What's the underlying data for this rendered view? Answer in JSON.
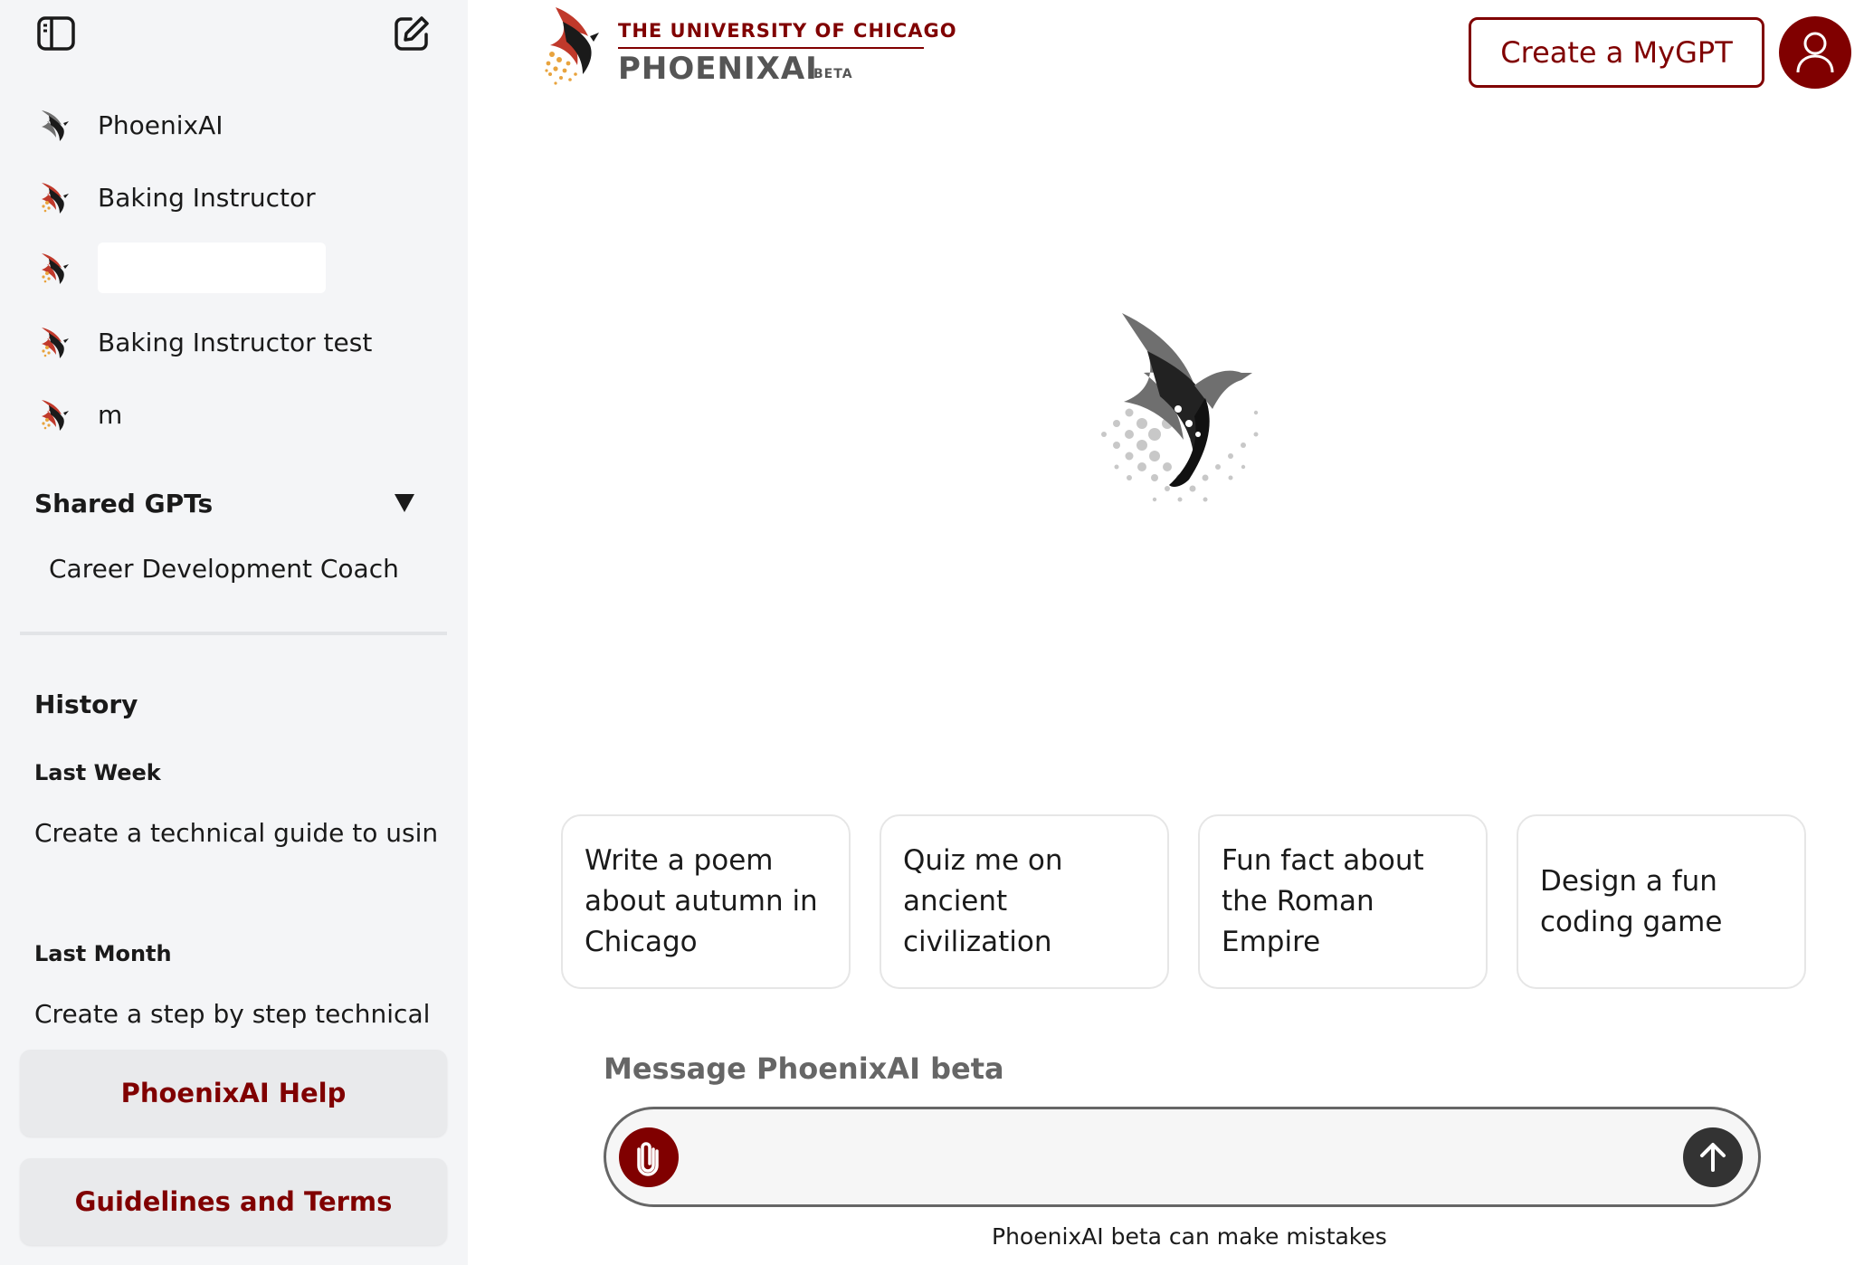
{
  "sidebar": {
    "toggle_icon": "sidebar-toggle-icon",
    "new_chat_icon": "edit-icon",
    "gpts": [
      {
        "label": "PhoenixAI",
        "icon": "phoenix-icon"
      },
      {
        "label": "Baking Instructor",
        "icon": "phoenix-icon"
      },
      {
        "label": "",
        "icon": "phoenix-icon"
      },
      {
        "label": "Baking Instructor test",
        "icon": "phoenix-icon"
      },
      {
        "label": "m",
        "icon": "phoenix-icon"
      }
    ],
    "shared_title": "Shared GPTs",
    "shared_items": [
      "Career Development Coach"
    ],
    "history_title": "History",
    "history": [
      {
        "group": "Last Week",
        "items": [
          "Create a technical guide to using"
        ]
      },
      {
        "group": "Last Month",
        "items": [
          "Create a step by step technical guide"
        ]
      }
    ],
    "help_label": "PhoenixAI Help",
    "terms_label": "Guidelines and Terms"
  },
  "header": {
    "logo_university": "THE UNIVERSITY OF CHICAGO",
    "logo_name": "PHOENIXAI",
    "logo_badge": "BETA",
    "create_label": "Create a MyGPT",
    "avatar_icon": "user-icon"
  },
  "main": {
    "suggestions": [
      "Write a poem about autumn in Chicago",
      "Quiz me on ancient civilization",
      "Fun fact about the Roman Empire",
      "Design a fun coding game"
    ],
    "message_label": "Message PhoenixAI beta",
    "message_placeholder": "",
    "disclaimer": "PhoenixAI beta can make mistakes"
  },
  "colors": {
    "brand": "#800000",
    "sidebar_bg": "#f4f5f7",
    "button_bg": "#e9eaec",
    "send_bg": "#333333"
  }
}
